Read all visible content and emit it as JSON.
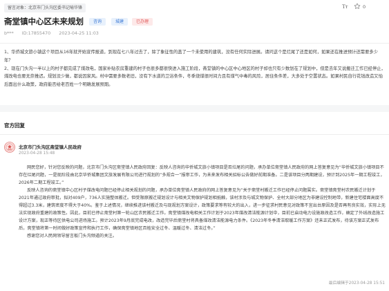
{
  "header": {
    "recipient_tag": "留言对象：北京市门头沟区委书记喻华锋",
    "font_size_label": "Tт",
    "favorite_count": "0"
  },
  "message": {
    "title": "斋堂镇中心区未来规划",
    "badges": [
      "咨询",
      "城建",
      "已办理"
    ],
    "author": "b***",
    "id_label": "ID:1785547​0",
    "date": "2023-04-25 11:03",
    "paragraphs": [
      "1、华侨城文旅小镇这个项目从16年就开始宣传报道，到现在七八年过去了，除了象征性的盖了一个未使用的建筑，没有任何实际进展。请问这个是烂尾了还是如何，如果还在推进预计还需要多少年？",
      "2、现在门头沟一半以上的村子都完成了煤改电，国家补贴农房重建的村子也很多都很快进入施工阶段，斋堂镇的中心区中心地区的村子却也只有少数划在了规划中，但是去年又说搬迁工作已经停止，煤改电也要无奈推迟。规划没少做，都说因家风。村中需要多数老旧，没有下水道的卫浴条件，冬季烧煤很时间力且有煤气中毒的风险，居住条件差，大多处于空置状态。如果村民自行花钱改造又怕后面出什么政策，政府能否给老百姓一个明确发展预期。"
    ]
  },
  "official_reply": {
    "section_title": "官方回复",
    "org_name": "北京市门头沟区斋堂镇人民政府",
    "reply_time": "2023-04-28 15:48",
    "paragraphs": [
      "网民您好，针对您反映的问题，北京市门头沟区斋堂镇人民政府回复：反映人咨询的华侨城文旅小镇项目是否烂尾的问题，承办单位斋堂镇人民政府的网上答复意见为“华侨城文旅小镇项目不存在烂尾问题，一是现阶段由北京华侨城集团文旅发展有限公司进行规划的“多规合一”报审工作，为未来发布相关招标公告做好前期准备。二是该项目分两期建设，预计到2025年一期工程竣工，2026年二期工程竣工。”",
      "反映人咨询的斋堂镇中心区村子煤改电问题已经停止相关规划的问题，承办单位斋堂镇人民政府的网上答复意见为“关于斋堂村搬迁工作已经停止问题属实。斋堂镇斋堂村农民搬迁计划于2021年通过政府审批，拟对409户，736人实施整体搬迁。但受限原搬迁规划设计与相关文物保护规划相抵触，该村涉及与城文物保护、全村大部分地区为非建设控制地带，新建住宅楼面高度不得超过3.3米，建筑密度不得大于40%。鉴于上述情况，继续推进该村搬迁及与现规划方案设计，政策要求等有较大的出入，进一步征求村民意见对政策不宜出台原因及是否再有良实效，实际上无法实现政府重建的政策性。因此，目前已停止斋堂村第一轮山区农民搬迁工作。斋堂镇煤改电相关工作计划于2023年煤改清洁能源计划中，目前已启动电力设施政改造工作，确定了外线改造施工设计方案，现正等待区供电公司进场施工。预计2023年9月底完成电改，改造完毕后斋堂村将具备煤改清洁能源电力条件。《2023年冬季清洁取暖工作方案》还未正式发布，待该方案正式发布后，斋堂镇将第一时间做好政策宣传和执行工作，确保斋堂镇地区百姓安全过冬、温暖过冬、清洁过冬。”",
      "感谢您对人民网领导留言板门头沟频道的关注。"
    ],
    "last_update": "最后编辑于2023-04-28 15:51"
  },
  "colors": {
    "badge_blue_bg": "#e8f1fc",
    "badge_blue_text": "#3e7bd6",
    "badge_red_bg": "#fde9e9",
    "badge_red_text": "#e05555",
    "org_icon_color": "#d9534f"
  },
  "icons": {
    "favorite": "star-icon",
    "font_size": "font-size-icon",
    "org": "government-seal-icon"
  }
}
